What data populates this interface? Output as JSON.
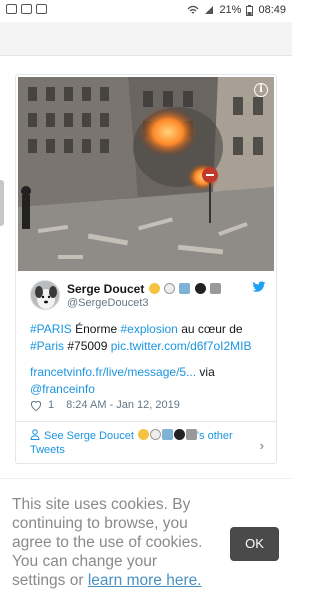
{
  "status_bar": {
    "battery": "21%",
    "time": "08:49"
  },
  "tweet": {
    "display_name": "Serge Doucet",
    "handle": "@SergeDoucet3",
    "text_parts": {
      "hashtag_paris": "#PARIS",
      "enorme": " Énorme ",
      "hashtag_explosion": "#explosion",
      "au_coeur": " au cœur de",
      "hashtag_paris2": "#Paris",
      "postcode": " #75009 ",
      "pic_link": "pic.twitter.com/d6f7oI2MIB",
      "francetv_link": "francetvinfo.fr/live/message/5...",
      "via": " via",
      "franceinfo": "@franceinfo"
    },
    "like_count": "1",
    "timestamp": "8:24 AM - Jan 12, 2019",
    "see_more_prefix": "See Serge Doucet",
    "see_more_suffix": "'s other Tweets"
  },
  "cookie_banner": {
    "text": "This site uses cookies. By continuing to browse, you agree to the use of cookies. You can change your settings or ",
    "link_text": "learn more here.",
    "ok_label": "OK"
  },
  "icons": [
    "notification-icon",
    "mail-icon",
    "image-icon",
    "wifi-icon",
    "signal-icon",
    "battery-icon",
    "info-icon",
    "twitter-bird-icon",
    "heart-icon",
    "profile-icon",
    "chevron-right-icon"
  ],
  "colors": {
    "link": "#1b95e0",
    "ok_button": "#4a4a4a",
    "cookie_text": "#8a8a8a"
  }
}
